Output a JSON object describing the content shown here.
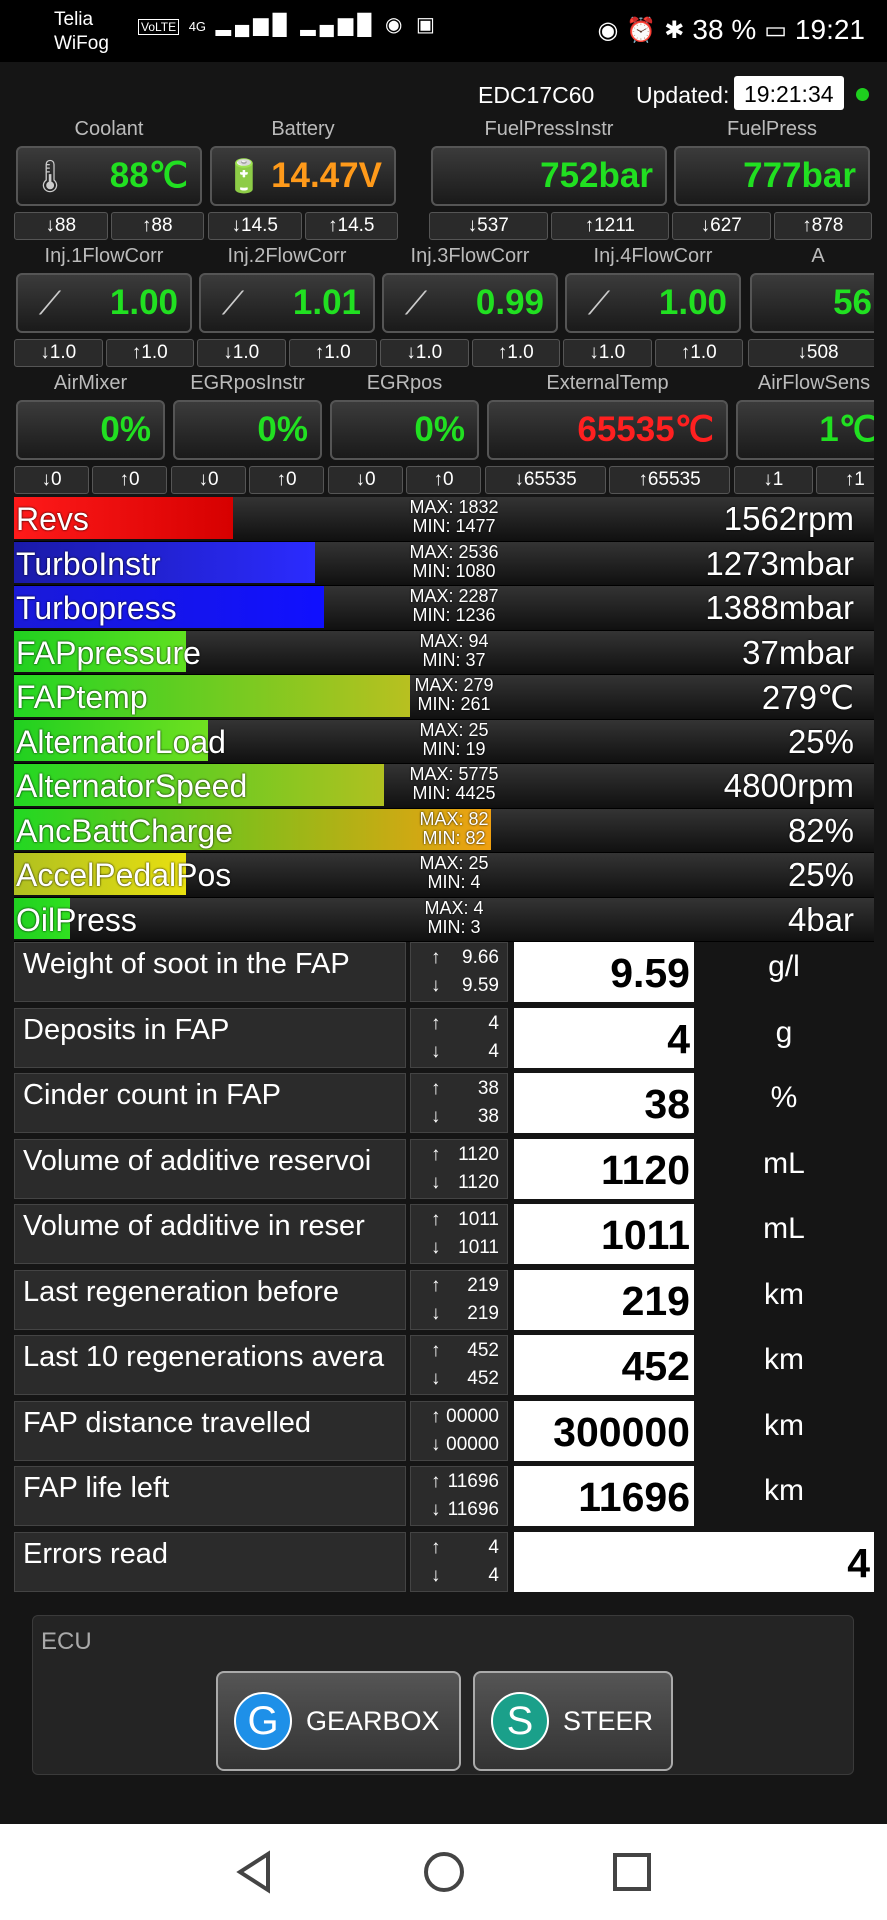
{
  "status": {
    "carrier": "Telia",
    "wifi": "WiFog",
    "volte": "VoLTE",
    "net": "4G",
    "battery": "38 %",
    "time": "19:21"
  },
  "header": {
    "ecu": "EDC17C60",
    "updated_label": "Updated:",
    "updated_time": "19:21:34"
  },
  "gauge_rows": [
    [
      {
        "label": "Coolant",
        "value": "88℃",
        "color": "#21e021",
        "min": "88",
        "max": "88",
        "icon": "coolant-icon",
        "glyph": "🌡"
      },
      {
        "label": "Battery",
        "value": "14.47V",
        "color": "#ff9a1a",
        "min": "14.5",
        "max": "14.5",
        "icon": "battery-icon",
        "glyph": "🔋"
      },
      {
        "label": "FuelPressInstr",
        "value": "752bar",
        "color": "#21e021",
        "min": "537",
        "max": "1211"
      },
      {
        "label": "FuelPress",
        "value": "777bar",
        "color": "#21e021",
        "min": "627",
        "max": "878"
      }
    ],
    [
      {
        "label": "Inj.1FlowCorr",
        "value": "1.00",
        "color": "#21e021",
        "min": "1.0",
        "max": "1.0",
        "icon": "injector-icon",
        "glyph": "⟋"
      },
      {
        "label": "Inj.2FlowCorr",
        "value": "1.01",
        "color": "#21e021",
        "min": "1.0",
        "max": "1.0",
        "icon": "injector-icon",
        "glyph": "⟋"
      },
      {
        "label": "Inj.3FlowCorr",
        "value": "0.99",
        "color": "#21e021",
        "min": "1.0",
        "max": "1.0",
        "icon": "injector-icon",
        "glyph": "⟋"
      },
      {
        "label": "Inj.4FlowCorr",
        "value": "1.00",
        "color": "#21e021",
        "min": "1.0",
        "max": "1.0",
        "icon": "injector-icon",
        "glyph": "⟋"
      },
      {
        "label": "A",
        "value": "56",
        "color": "#21e021",
        "min": "508",
        "max": ""
      }
    ],
    [
      {
        "label": "AirMixer",
        "value": "0%",
        "color": "#21e021",
        "min": "0",
        "max": "0"
      },
      {
        "label": "EGRposInstr",
        "value": "0%",
        "color": "#21e021",
        "min": "0",
        "max": "0"
      },
      {
        "label": "EGRpos",
        "value": "0%",
        "color": "#21e021",
        "min": "0",
        "max": "0"
      },
      {
        "label": "ExternalTemp",
        "value": "65535℃",
        "color": "#ff2020",
        "min": "65535",
        "max": "65535"
      },
      {
        "label": "AirFlowSens",
        "value": "1℃",
        "color": "#21e021",
        "min": "1",
        "max": "1"
      }
    ]
  ],
  "bars": [
    {
      "name": "Revs",
      "max": "MAX: 1832",
      "min": "MIN: 1477",
      "value": "1562rpm",
      "fill": 0.255,
      "grad": "#ff1a1a,#d60000"
    },
    {
      "name": "TurboInstr",
      "max": "MAX: 2536",
      "min": "MIN: 1080",
      "value": "1273mbar",
      "fill": 0.35,
      "grad": "#1a1aa8,#2b2bff"
    },
    {
      "name": "Turbopress",
      "max": "MAX: 2287",
      "min": "MIN: 1236",
      "value": "1388mbar",
      "fill": 0.36,
      "grad": "#1a1ad8,#1010ff"
    },
    {
      "name": "FAPpressure",
      "max": "MAX: 94",
      "min": "MIN: 37",
      "value": "37mbar",
      "fill": 0.2,
      "grad": "#20d020,#60e020"
    },
    {
      "name": "FAPtemp",
      "max": "MAX: 279",
      "min": "MIN: 261",
      "value": "279℃",
      "fill": 0.46,
      "grad": "#22d822,#b8c020"
    },
    {
      "name": "AlternatorLoad",
      "max": "MAX: 25",
      "min": "MIN: 19",
      "value": "25%",
      "fill": 0.225,
      "grad": "#20d020,#70e020"
    },
    {
      "name": "AlternatorSpeed",
      "max": "MAX: 5775",
      "min": "MIN: 4425",
      "value": "4800rpm",
      "fill": 0.43,
      "grad": "#22d822,#b0c020"
    },
    {
      "name": "AncBattCharge",
      "max": "MAX: 82",
      "min": "MIN: 82",
      "value": "82%",
      "fill": 0.555,
      "grad": "#22d822,#f0a010"
    },
    {
      "name": "AccelPedalPos",
      "max": "MAX: 25",
      "min": "MIN: 4",
      "value": "25%",
      "fill": 0.2,
      "grad": "#b0c020,#e8e010"
    },
    {
      "name": "OilPress",
      "max": "MAX: 4",
      "min": "MIN: 3",
      "value": "4bar",
      "fill": 0.065,
      "grad": "#20d020,#30e020"
    }
  ],
  "table": [
    {
      "label": "Weight of soot in the FAP",
      "max": "9.66",
      "min": "9.59",
      "value": "9.59",
      "unit": "g/l"
    },
    {
      "label": "Deposits in FAP",
      "max": "4",
      "min": "4",
      "value": "4",
      "unit": "g"
    },
    {
      "label": "Cinder count in FAP",
      "max": "38",
      "min": "38",
      "value": "38",
      "unit": "%"
    },
    {
      "label": "Volume of additive reservoi",
      "max": "1120",
      "min": "1120",
      "value": "1120",
      "unit": "mL"
    },
    {
      "label": "Volume of additive in reser",
      "max": "1011",
      "min": "1011",
      "value": "1011",
      "unit": "mL"
    },
    {
      "label": "Last regeneration before",
      "max": "219",
      "min": "219",
      "value": "219",
      "unit": "km"
    },
    {
      "label": "Last 10 regenerations avera",
      "max": "452",
      "min": "452",
      "value": "452",
      "unit": "km"
    },
    {
      "label": "FAP distance travelled",
      "max": "00000",
      "min": "00000",
      "value": "300000",
      "unit": "km"
    },
    {
      "label": "FAP life left",
      "max": "11696",
      "min": "11696",
      "value": "11696",
      "unit": "km"
    },
    {
      "label": "Errors read",
      "max": "4",
      "min": "4",
      "value": "4",
      "unit": ""
    }
  ],
  "ecu": {
    "title": "ECU",
    "buttons": [
      {
        "letter": "G",
        "label": "GEARBOX",
        "color": "#1e90e8"
      },
      {
        "letter": "S",
        "label": "STEER",
        "color": "#1aa08a"
      }
    ]
  }
}
